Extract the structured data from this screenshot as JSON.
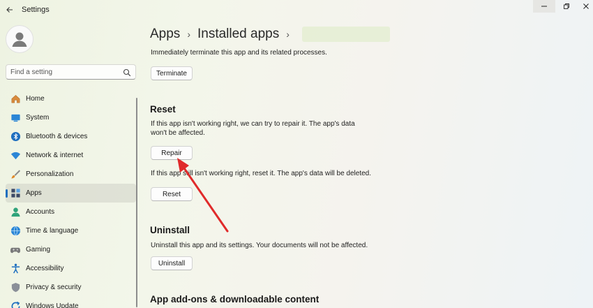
{
  "window": {
    "title": "Settings"
  },
  "sidebar": {
    "search_placeholder": "Find a setting",
    "items": [
      {
        "label": "Home",
        "icon": "home-icon"
      },
      {
        "label": "System",
        "icon": "system-icon"
      },
      {
        "label": "Bluetooth & devices",
        "icon": "bluetooth-icon"
      },
      {
        "label": "Network & internet",
        "icon": "wifi-icon"
      },
      {
        "label": "Personalization",
        "icon": "brush-icon"
      },
      {
        "label": "Apps",
        "icon": "apps-icon",
        "active": true
      },
      {
        "label": "Accounts",
        "icon": "accounts-icon"
      },
      {
        "label": "Time & language",
        "icon": "globe-icon"
      },
      {
        "label": "Gaming",
        "icon": "gamepad-icon"
      },
      {
        "label": "Accessibility",
        "icon": "accessibility-icon"
      },
      {
        "label": "Privacy & security",
        "icon": "shield-icon"
      },
      {
        "label": "Windows Update",
        "icon": "update-icon"
      }
    ]
  },
  "breadcrumb": {
    "level1": "Apps",
    "level2": "Installed apps"
  },
  "main": {
    "terminate_desc": "Immediately terminate this app and its related processes.",
    "terminate_button": "Terminate",
    "reset_heading": "Reset",
    "repair_desc_line1": "If this app isn't working right, we can try to repair it. The app's data",
    "repair_desc_line2": "won't be affected.",
    "repair_button": "Repair",
    "reset_desc": "If this app still isn't working right, reset it. The app's data will be deleted.",
    "reset_button": "Reset",
    "uninstall_heading": "Uninstall",
    "uninstall_desc": "Uninstall this app and its settings. Your documents will not be affected.",
    "uninstall_button": "Uninstall",
    "addons_heading": "App add-ons & downloadable content"
  },
  "colors": {
    "accent": "#1f6fbf",
    "annotation_arrow": "#e02a2a"
  }
}
